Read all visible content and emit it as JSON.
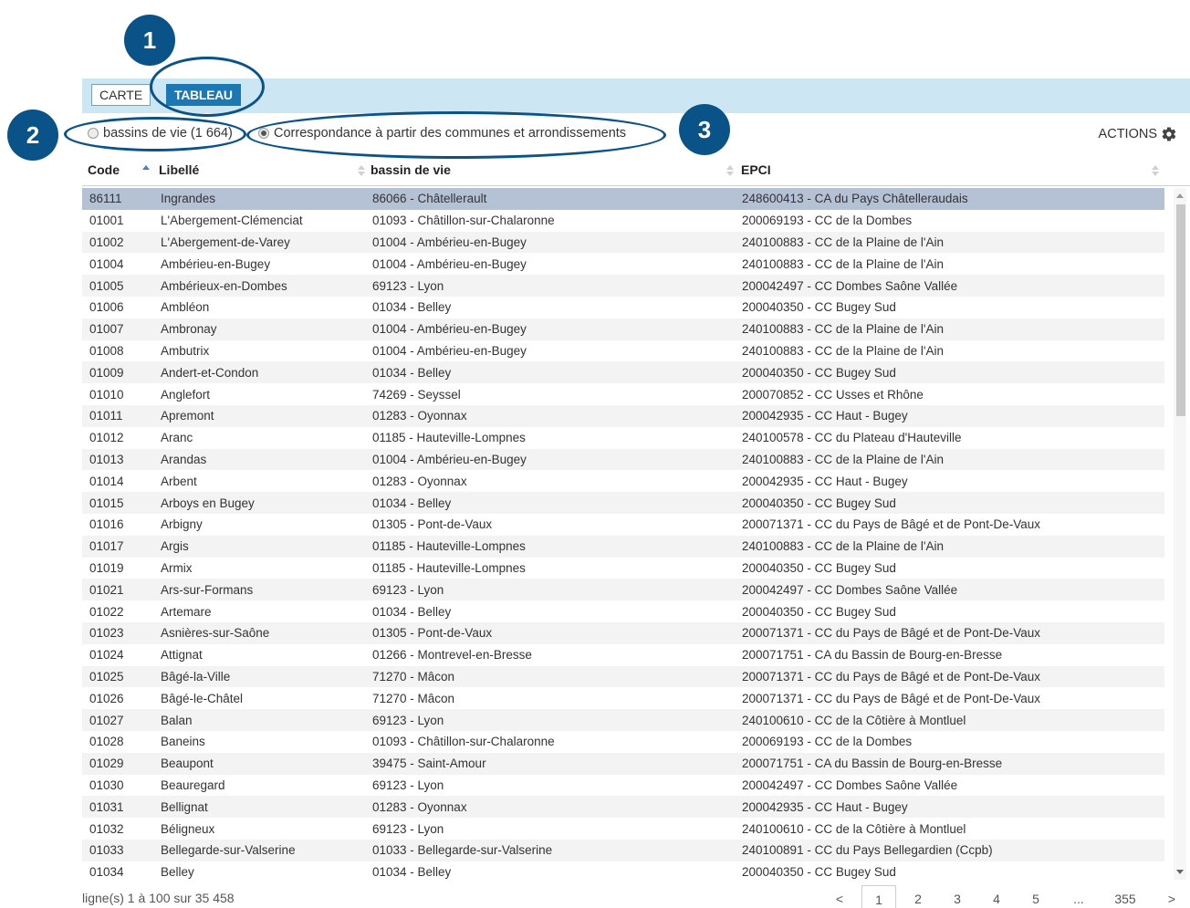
{
  "callouts": [
    "1",
    "2",
    "3"
  ],
  "tabs": {
    "carte": "CARTE",
    "tableau": "TABLEAU"
  },
  "options": {
    "radio1": "bassins de vie (1 664)",
    "radio2": "Correspondance à partir des communes et arrondissements",
    "actions": "ACTIONS"
  },
  "columns": {
    "code": "Code",
    "libelle": "Libellé",
    "bassin": "bassin de vie",
    "epci": "EPCI"
  },
  "rows": [
    [
      "86111",
      "Ingrandes",
      "86066 - Châtellerault",
      "248600413 - CA du Pays Châtelleraudais"
    ],
    [
      "01001",
      "L'Abergement-Clémenciat",
      "01093 - Châtillon-sur-Chalaronne",
      "200069193 - CC de la Dombes"
    ],
    [
      "01002",
      "L'Abergement-de-Varey",
      "01004 - Ambérieu-en-Bugey",
      "240100883 - CC de la Plaine de l'Ain"
    ],
    [
      "01004",
      "Ambérieu-en-Bugey",
      "01004 - Ambérieu-en-Bugey",
      "240100883 - CC de la Plaine de l'Ain"
    ],
    [
      "01005",
      "Ambérieux-en-Dombes",
      "69123 - Lyon",
      "200042497 - CC Dombes Saône Vallée"
    ],
    [
      "01006",
      "Ambléon",
      "01034 - Belley",
      "200040350 - CC Bugey Sud"
    ],
    [
      "01007",
      "Ambronay",
      "01004 - Ambérieu-en-Bugey",
      "240100883 - CC de la Plaine de l'Ain"
    ],
    [
      "01008",
      "Ambutrix",
      "01004 - Ambérieu-en-Bugey",
      "240100883 - CC de la Plaine de l'Ain"
    ],
    [
      "01009",
      "Andert-et-Condon",
      "01034 - Belley",
      "200040350 - CC Bugey Sud"
    ],
    [
      "01010",
      "Anglefort",
      "74269 - Seyssel",
      "200070852 - CC Usses et Rhône"
    ],
    [
      "01011",
      "Apremont",
      "01283 - Oyonnax",
      "200042935 - CC Haut - Bugey"
    ],
    [
      "01012",
      "Aranc",
      "01185 - Hauteville-Lompnes",
      "240100578 - CC du Plateau d'Hauteville"
    ],
    [
      "01013",
      "Arandas",
      "01004 - Ambérieu-en-Bugey",
      "240100883 - CC de la Plaine de l'Ain"
    ],
    [
      "01014",
      "Arbent",
      "01283 - Oyonnax",
      "200042935 - CC Haut - Bugey"
    ],
    [
      "01015",
      "Arboys en Bugey",
      "01034 - Belley",
      "200040350 - CC Bugey Sud"
    ],
    [
      "01016",
      "Arbigny",
      "01305 - Pont-de-Vaux",
      "200071371 - CC du Pays de Bâgé et de Pont-De-Vaux"
    ],
    [
      "01017",
      "Argis",
      "01185 - Hauteville-Lompnes",
      "240100883 - CC de la Plaine de l'Ain"
    ],
    [
      "01019",
      "Armix",
      "01185 - Hauteville-Lompnes",
      "200040350 - CC Bugey Sud"
    ],
    [
      "01021",
      "Ars-sur-Formans",
      "69123 - Lyon",
      "200042497 - CC Dombes Saône Vallée"
    ],
    [
      "01022",
      "Artemare",
      "01034 - Belley",
      "200040350 - CC Bugey Sud"
    ],
    [
      "01023",
      "Asnières-sur-Saône",
      "01305 - Pont-de-Vaux",
      "200071371 - CC du Pays de Bâgé et de Pont-De-Vaux"
    ],
    [
      "01024",
      "Attignat",
      "01266 - Montrevel-en-Bresse",
      "200071751 - CA du Bassin de Bourg-en-Bresse"
    ],
    [
      "01025",
      "Bâgé-la-Ville",
      "71270 - Mâcon",
      "200071371 - CC du Pays de Bâgé et de Pont-De-Vaux"
    ],
    [
      "01026",
      "Bâgé-le-Châtel",
      "71270 - Mâcon",
      "200071371 - CC du Pays de Bâgé et de Pont-De-Vaux"
    ],
    [
      "01027",
      "Balan",
      "69123 - Lyon",
      "240100610 - CC de la Côtière à Montluel"
    ],
    [
      "01028",
      "Baneins",
      "01093 - Châtillon-sur-Chalaronne",
      "200069193 - CC de la Dombes"
    ],
    [
      "01029",
      "Beaupont",
      "39475 - Saint-Amour",
      "200071751 - CA du Bassin de Bourg-en-Bresse"
    ],
    [
      "01030",
      "Beauregard",
      "69123 - Lyon",
      "200042497 - CC Dombes Saône Vallée"
    ],
    [
      "01031",
      "Bellignat",
      "01283 - Oyonnax",
      "200042935 - CC Haut - Bugey"
    ],
    [
      "01032",
      "Béligneux",
      "69123 - Lyon",
      "240100610 - CC de la Côtière à Montluel"
    ],
    [
      "01033",
      "Bellegarde-sur-Valserine",
      "01033 - Bellegarde-sur-Valserine",
      "240100891 - CC du Pays Bellegardien (Ccpb)"
    ],
    [
      "01034",
      "Belley",
      "01034 - Belley",
      "200040350 - CC Bugey Sud"
    ]
  ],
  "footer": {
    "info": "ligne(s) 1 à 100 sur 35 458",
    "prev": "<",
    "pages": [
      "1",
      "2",
      "3",
      "4",
      "5"
    ],
    "ellipsis": "...",
    "last": "355",
    "next": ">"
  },
  "colors": {
    "callout": "#0a5389",
    "tab_bar": "#cde6f3",
    "tab_active": "#1c78b5",
    "selected_row": "#b5c2d6"
  }
}
